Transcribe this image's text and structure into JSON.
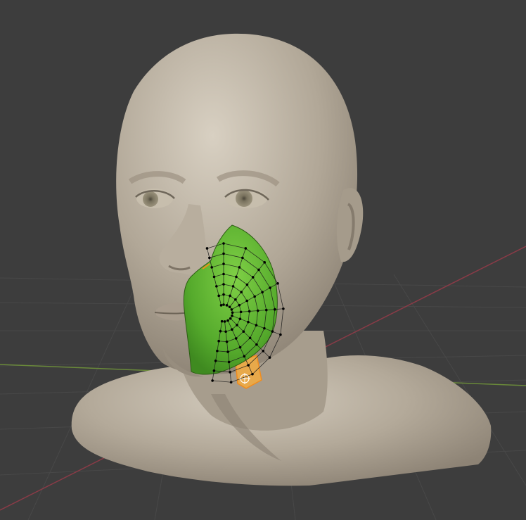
{
  "viewport": {
    "background": "#3d3d3d",
    "grid_color": "#484848",
    "x_axis_color": "#8a3b47",
    "y_axis_color": "#6a8a3a"
  },
  "head": {
    "skin_color": "#b2a898",
    "skin_shadow": "#8e8476",
    "skin_highlight": "#cfc6b8",
    "iris_color": "#7a735f"
  },
  "mesh_patch": {
    "fill": "#55aa2c",
    "fill_light": "#6cc23b",
    "wire_color": "#1a1a1a",
    "vertex_color": "#000000"
  },
  "selection": {
    "color": "#f08c1e",
    "fill": "#e8a94a"
  }
}
